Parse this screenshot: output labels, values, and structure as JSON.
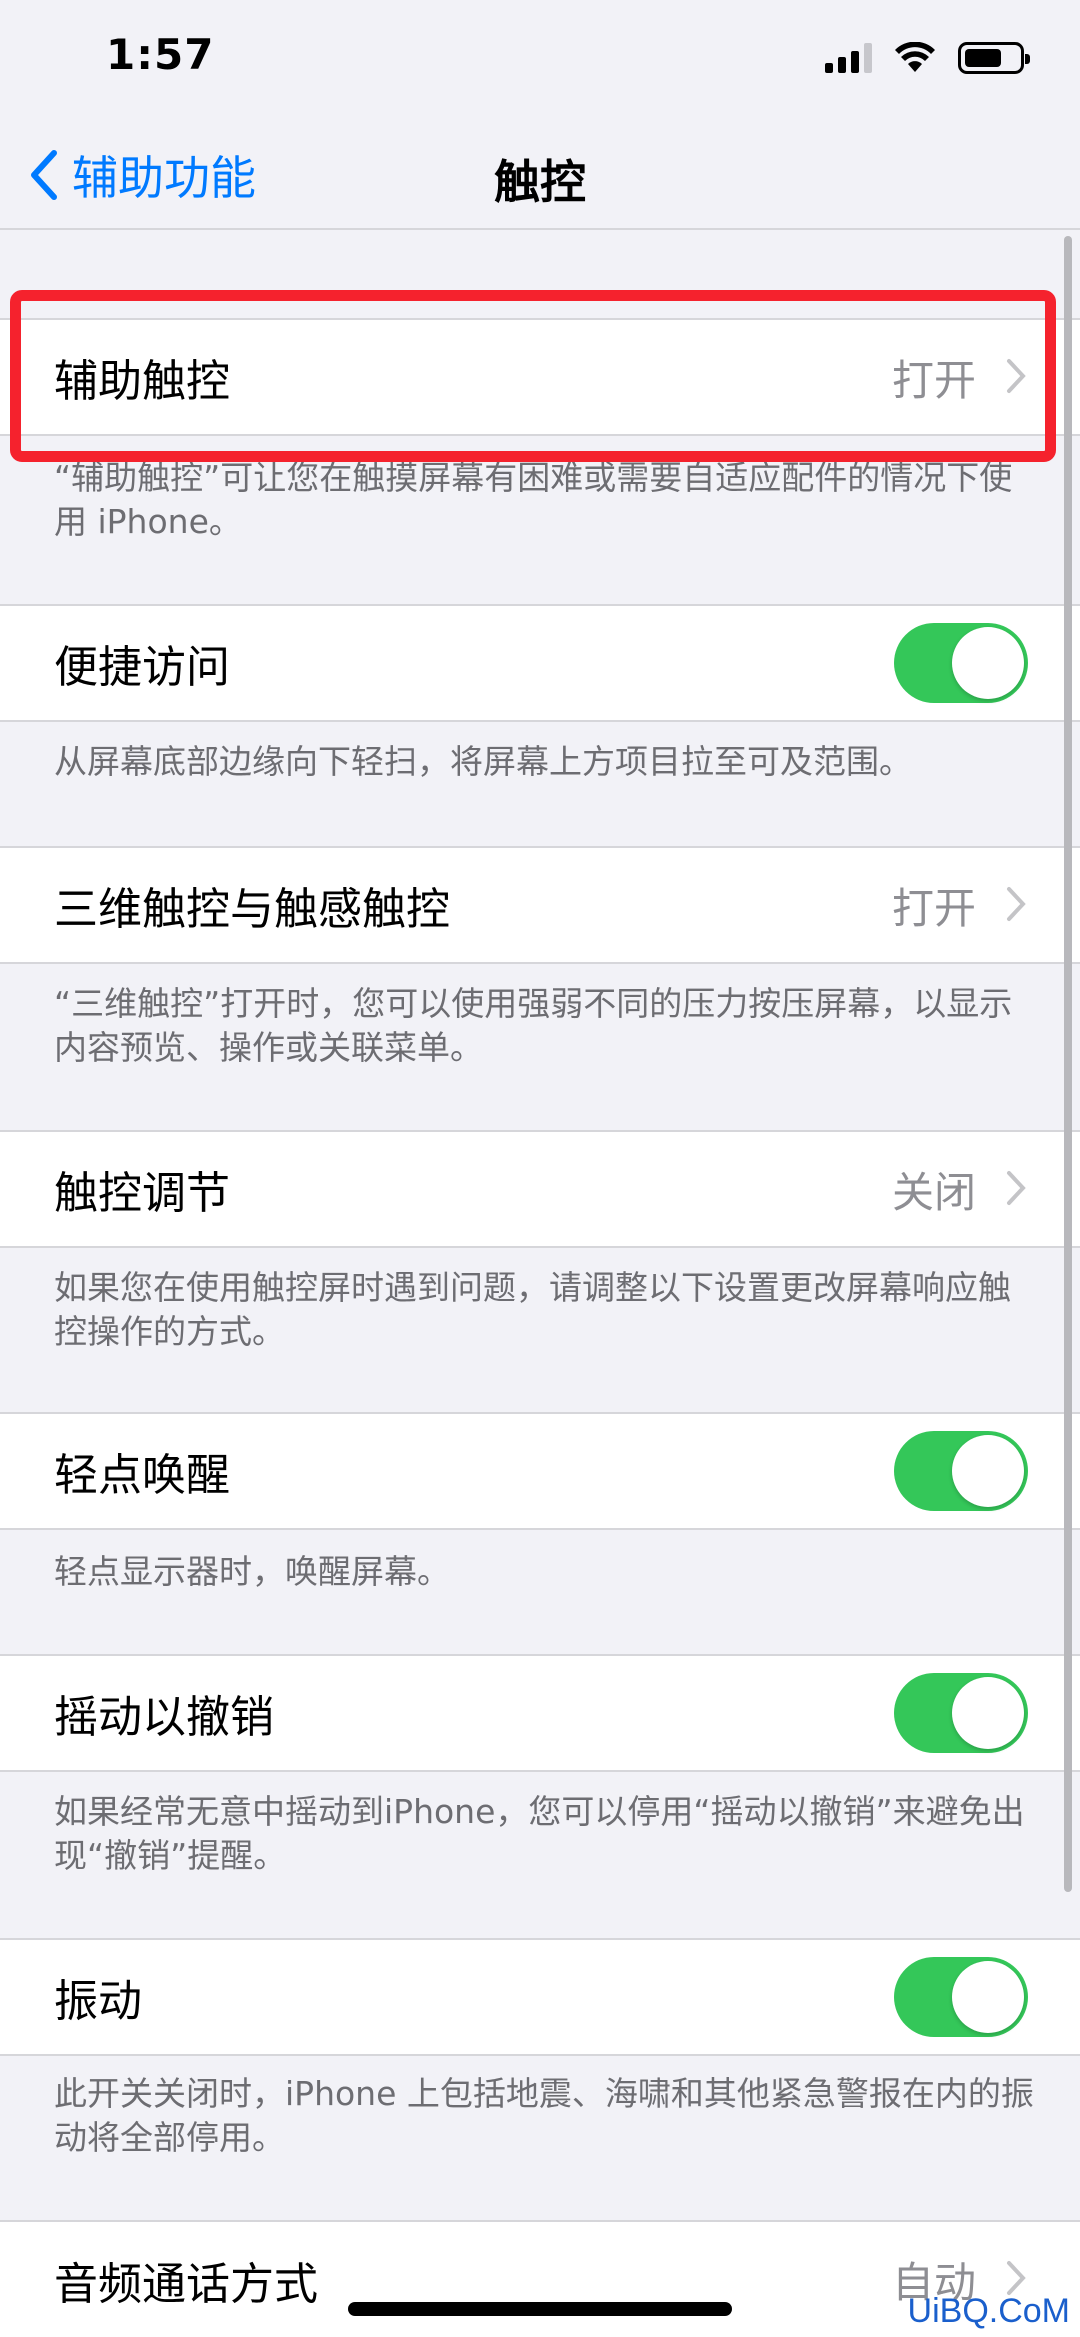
{
  "status": {
    "time": "1:57"
  },
  "nav": {
    "back_label": "辅助功能",
    "title": "触控"
  },
  "items": [
    {
      "label": "辅助触控",
      "value": "打开",
      "footer": "“辅助触控”可让您在触摸屏幕有困难或需要自适应配件的情况下使用 iPhone。"
    },
    {
      "label": "便捷访问",
      "toggle": true,
      "footer": "从屏幕底部边缘向下轻扫，将屏幕上方项目拉至可及范围。"
    },
    {
      "label": "三维触控与触感触控",
      "value": "打开",
      "footer": "“三维触控”打开时，您可以使用强弱不同的压力按压屏幕，以显示内容预览、操作或关联菜单。"
    },
    {
      "label": "触控调节",
      "value": "关闭",
      "footer": "如果您在使用触控屏时遇到问题，请调整以下设置更改屏幕响应触控操作的方式。"
    },
    {
      "label": "轻点唤醒",
      "toggle": true,
      "footer": "轻点显示器时，唤醒屏幕。"
    },
    {
      "label": "摇动以撤销",
      "toggle": true,
      "footer": "如果经常无意中摇动到iPhone，您可以停用“摇动以撤销”来避免出现“撤销”提醒。"
    },
    {
      "label": "振动",
      "toggle": true,
      "footer": "此开关关闭时，iPhone 上包括地震、海啸和其他紧急警报在内的振动将全部停用。"
    },
    {
      "label": "音频通话方式",
      "value": "自动"
    }
  ],
  "watermark": "UiBQ.CoM",
  "colors": {
    "accent": "#007aff",
    "toggle_on": "#34c759",
    "highlight": "#f5222d"
  }
}
